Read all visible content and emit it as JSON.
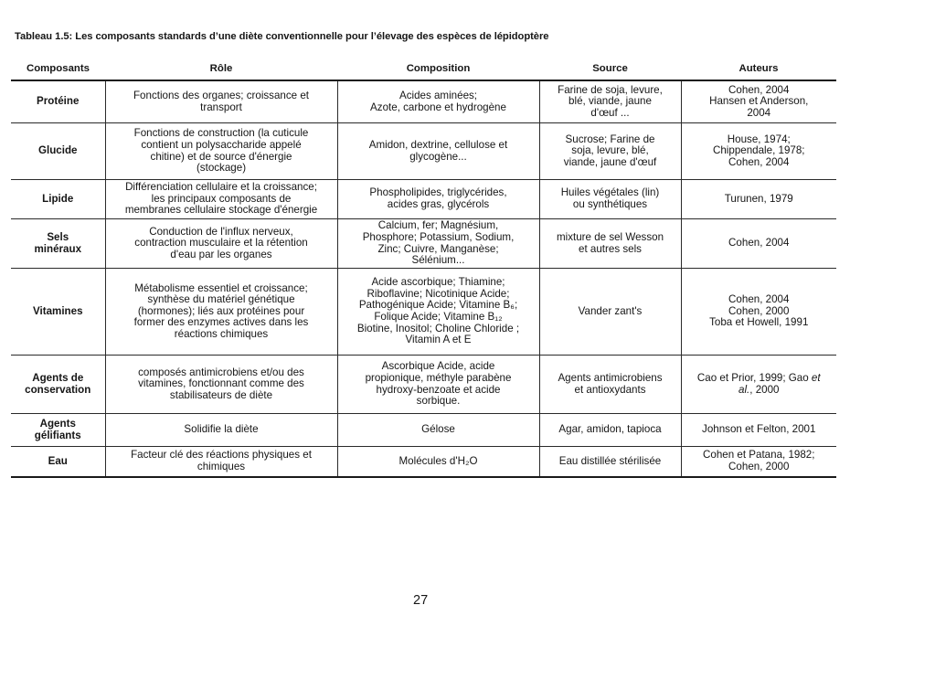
{
  "caption": "Tableau 1.5: Les composants standards d’une diète conventionnelle pour l’élevage des espèces de lépidoptère",
  "table": {
    "headers": [
      "Composants",
      "Rôle",
      "Composition",
      "Source",
      "Auteurs"
    ],
    "rows": [
      {
        "composant": [
          "Protéine"
        ],
        "role": [
          "Fonctions des organes; croissance et",
          "transport"
        ],
        "composition": [
          "Acides aminées;",
          "Azote, carbone et hydrogène"
        ],
        "source": [
          "Farine de soja, levure,",
          "blé, viande, jaune",
          "d'œuf ..."
        ],
        "auteurs": [
          "Cohen, 2004",
          "Hansen et Anderson,",
          "2004"
        ]
      },
      {
        "composant": [
          "Glucide"
        ],
        "role": [
          "Fonctions de construction (la cuticule",
          "contient un polysaccharide appelé",
          "chitine) et de source d'énergie",
          "(stockage)"
        ],
        "composition": [
          "Amidon, dextrine, cellulose et",
          "glycogène..."
        ],
        "source": [
          "Sucrose; Farine de",
          "soja, levure, blé,",
          "viande, jaune d'œuf"
        ],
        "auteurs": [
          "House, 1974;",
          "Chippendale, 1978;",
          "Cohen, 2004"
        ]
      },
      {
        "composant": [
          "Lipide"
        ],
        "role": [
          "Différenciation cellulaire et la croissance;",
          "les principaux composants de",
          "membranes cellulaire stockage d'énergie"
        ],
        "composition": [
          "Phospholipides, triglycérides,",
          "acides gras, glycérols"
        ],
        "source": [
          "Huiles végétales (lin)",
          "ou synthétiques"
        ],
        "auteurs": [
          "Turunen, 1979"
        ]
      },
      {
        "composant": [
          "Sels",
          "minéraux"
        ],
        "role": [
          "Conduction de l'influx nerveux,",
          "contraction musculaire et la rétention",
          "d'eau par les organes"
        ],
        "composition": [
          "Calcium, fer; Magnésium,",
          "Phosphore; Potassium, Sodium,",
          "Zinc; Cuivre, Manganèse;",
          "Sélénium..."
        ],
        "source": [
          "mixture de sel Wesson",
          "et autres sels"
        ],
        "auteurs": [
          "Cohen, 2004"
        ]
      },
      {
        "composant": [
          "Vitamines"
        ],
        "role": [
          "Métabolisme essentiel et croissance;",
          "synthèse du matériel génétique",
          "(hormones); liés aux protéines pour",
          "former des enzymes actives dans les",
          "réactions chimiques"
        ],
        "composition": [
          "Acide ascorbique; Thiamine;",
          "Riboflavine; Nicotinique Acide;",
          "Pathogénique Acide; Vitamine B₆;",
          "Folique Acide; Vitamine B₁₂",
          "Biotine, Inositol; Choline Chloride ;",
          "Vitamin A et E"
        ],
        "source": [
          "Vander zant's"
        ],
        "auteurs": [
          "Cohen, 2004",
          "Cohen, 2000",
          "Toba et Howell, 1991"
        ]
      },
      {
        "composant": [
          "Agents de",
          "conservation"
        ],
        "role": [
          "composés antimicrobiens et/ou des",
          "vitamines, fonctionnant comme des",
          "stabilisateurs de diète"
        ],
        "composition": [
          "Ascorbique Acide, acide",
          "propionique, méthyle parabène",
          "hydroxy-benzoate et  acide",
          "sorbique."
        ],
        "source": [
          "Agents antimicrobiens",
          "et antioxydants"
        ],
        "auteurs": [
          "Cao et Prior, 1999; Gao et",
          "al., 2000"
        ]
      },
      {
        "composant": [
          "Agents",
          "gélifiants"
        ],
        "role": [
          "Solidifie la diète"
        ],
        "composition": [
          "Gélose"
        ],
        "source": [
          "Agar, amidon, tapioca"
        ],
        "auteurs": [
          "Johnson et Felton, 2001"
        ]
      },
      {
        "composant": [
          "Eau"
        ],
        "role": [
          "Facteur clé des réactions physiques et",
          "chimiques"
        ],
        "composition": [
          "Molécules d'H₂O"
        ],
        "source": [
          "Eau distillée stérilisée"
        ],
        "auteurs": [
          "Cohen et Patana, 1982;",
          "Cohen, 2000"
        ]
      }
    ]
  },
  "page_number": "27"
}
